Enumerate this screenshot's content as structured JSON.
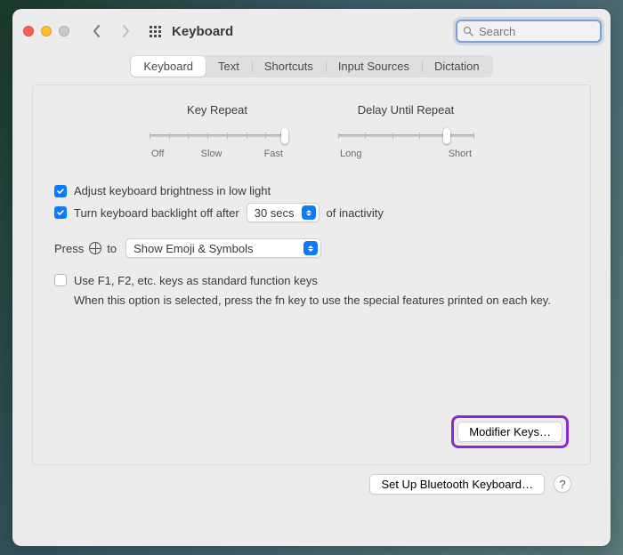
{
  "window": {
    "title": "Keyboard"
  },
  "search": {
    "placeholder": "Search"
  },
  "tabs": [
    "Keyboard",
    "Text",
    "Shortcuts",
    "Input Sources",
    "Dictation"
  ],
  "active_tab": "Keyboard",
  "sliders": {
    "key_repeat": {
      "title": "Key Repeat",
      "labels": [
        "Off",
        "Slow",
        "Fast"
      ],
      "ticks": 8,
      "value": 7
    },
    "delay": {
      "title": "Delay Until Repeat",
      "labels": [
        "Long",
        "Short"
      ],
      "ticks": 6,
      "value": 4
    }
  },
  "checks": {
    "brightness": {
      "checked": true,
      "label": "Adjust keyboard brightness in low light"
    },
    "backlight": {
      "checked": true,
      "prefix": "Turn keyboard backlight off after",
      "value": "30 secs",
      "suffix": "of inactivity"
    },
    "fnkeys": {
      "checked": false,
      "label": "Use F1, F2, etc. keys as standard function keys",
      "help": "When this option is selected, press the fn key to use the special features printed on each key."
    }
  },
  "globe_row": {
    "prefix": "Press",
    "suffix": "to",
    "value": "Show Emoji & Symbols"
  },
  "buttons": {
    "modifier": "Modifier Keys…",
    "bluetooth": "Set Up Bluetooth Keyboard…",
    "help": "?"
  }
}
